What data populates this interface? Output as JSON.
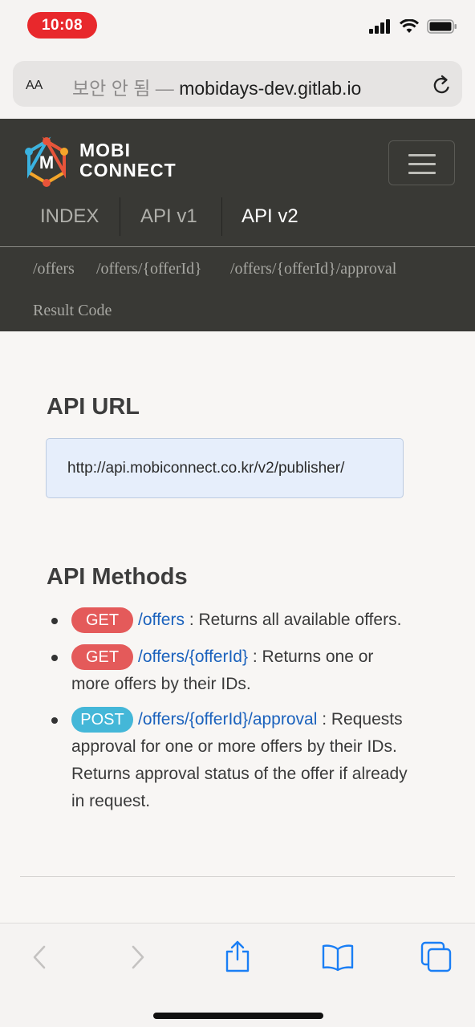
{
  "status_bar": {
    "time": "10:08"
  },
  "browser": {
    "text_size_label": "AA",
    "security_label": "보안 안 됨",
    "separator": " — ",
    "domain": "mobidays-dev.gitlab.io"
  },
  "site": {
    "logo_line1": "MOBI",
    "logo_line2": "CONNECT",
    "nav": [
      "INDEX",
      "API v1",
      "API v2"
    ],
    "active_nav": "API v2",
    "subnav": [
      "/offers",
      "/offers/{offerId}",
      "/offers/{offerId}/approval",
      "Result Code"
    ]
  },
  "content": {
    "api_url_title": "API URL",
    "api_url": "http://api.mobiconnect.co.kr/v2/publisher/",
    "methods_title": "API Methods",
    "methods": [
      {
        "verb": "GET",
        "path": "/offers",
        "desc_line1": " : Returns all available offers."
      },
      {
        "verb": "GET",
        "path": "/offers/{offerId}",
        "desc_line1": " : Returns one or",
        "desc_line2": "more offers by their IDs."
      },
      {
        "verb": "POST",
        "path": "/offers/{offerId}/approval",
        "desc_line1": " : Requests",
        "desc_line2": "approval for one or more offers by their IDs.",
        "desc_line3": "Returns approval status of the offer if already",
        "desc_line4": "in request."
      }
    ]
  },
  "colors": {
    "header_bg": "#393935",
    "get_badge": "#e45a5a",
    "post_badge": "#44b7d8",
    "link": "#1b62bd",
    "ios_blue": "#1a7ef5"
  },
  "icons": [
    "signal-icon",
    "wifi-icon",
    "battery-icon",
    "reload-icon",
    "hamburger-icon",
    "back-icon",
    "forward-icon",
    "share-icon",
    "bookmarks-icon",
    "tabs-icon"
  ]
}
